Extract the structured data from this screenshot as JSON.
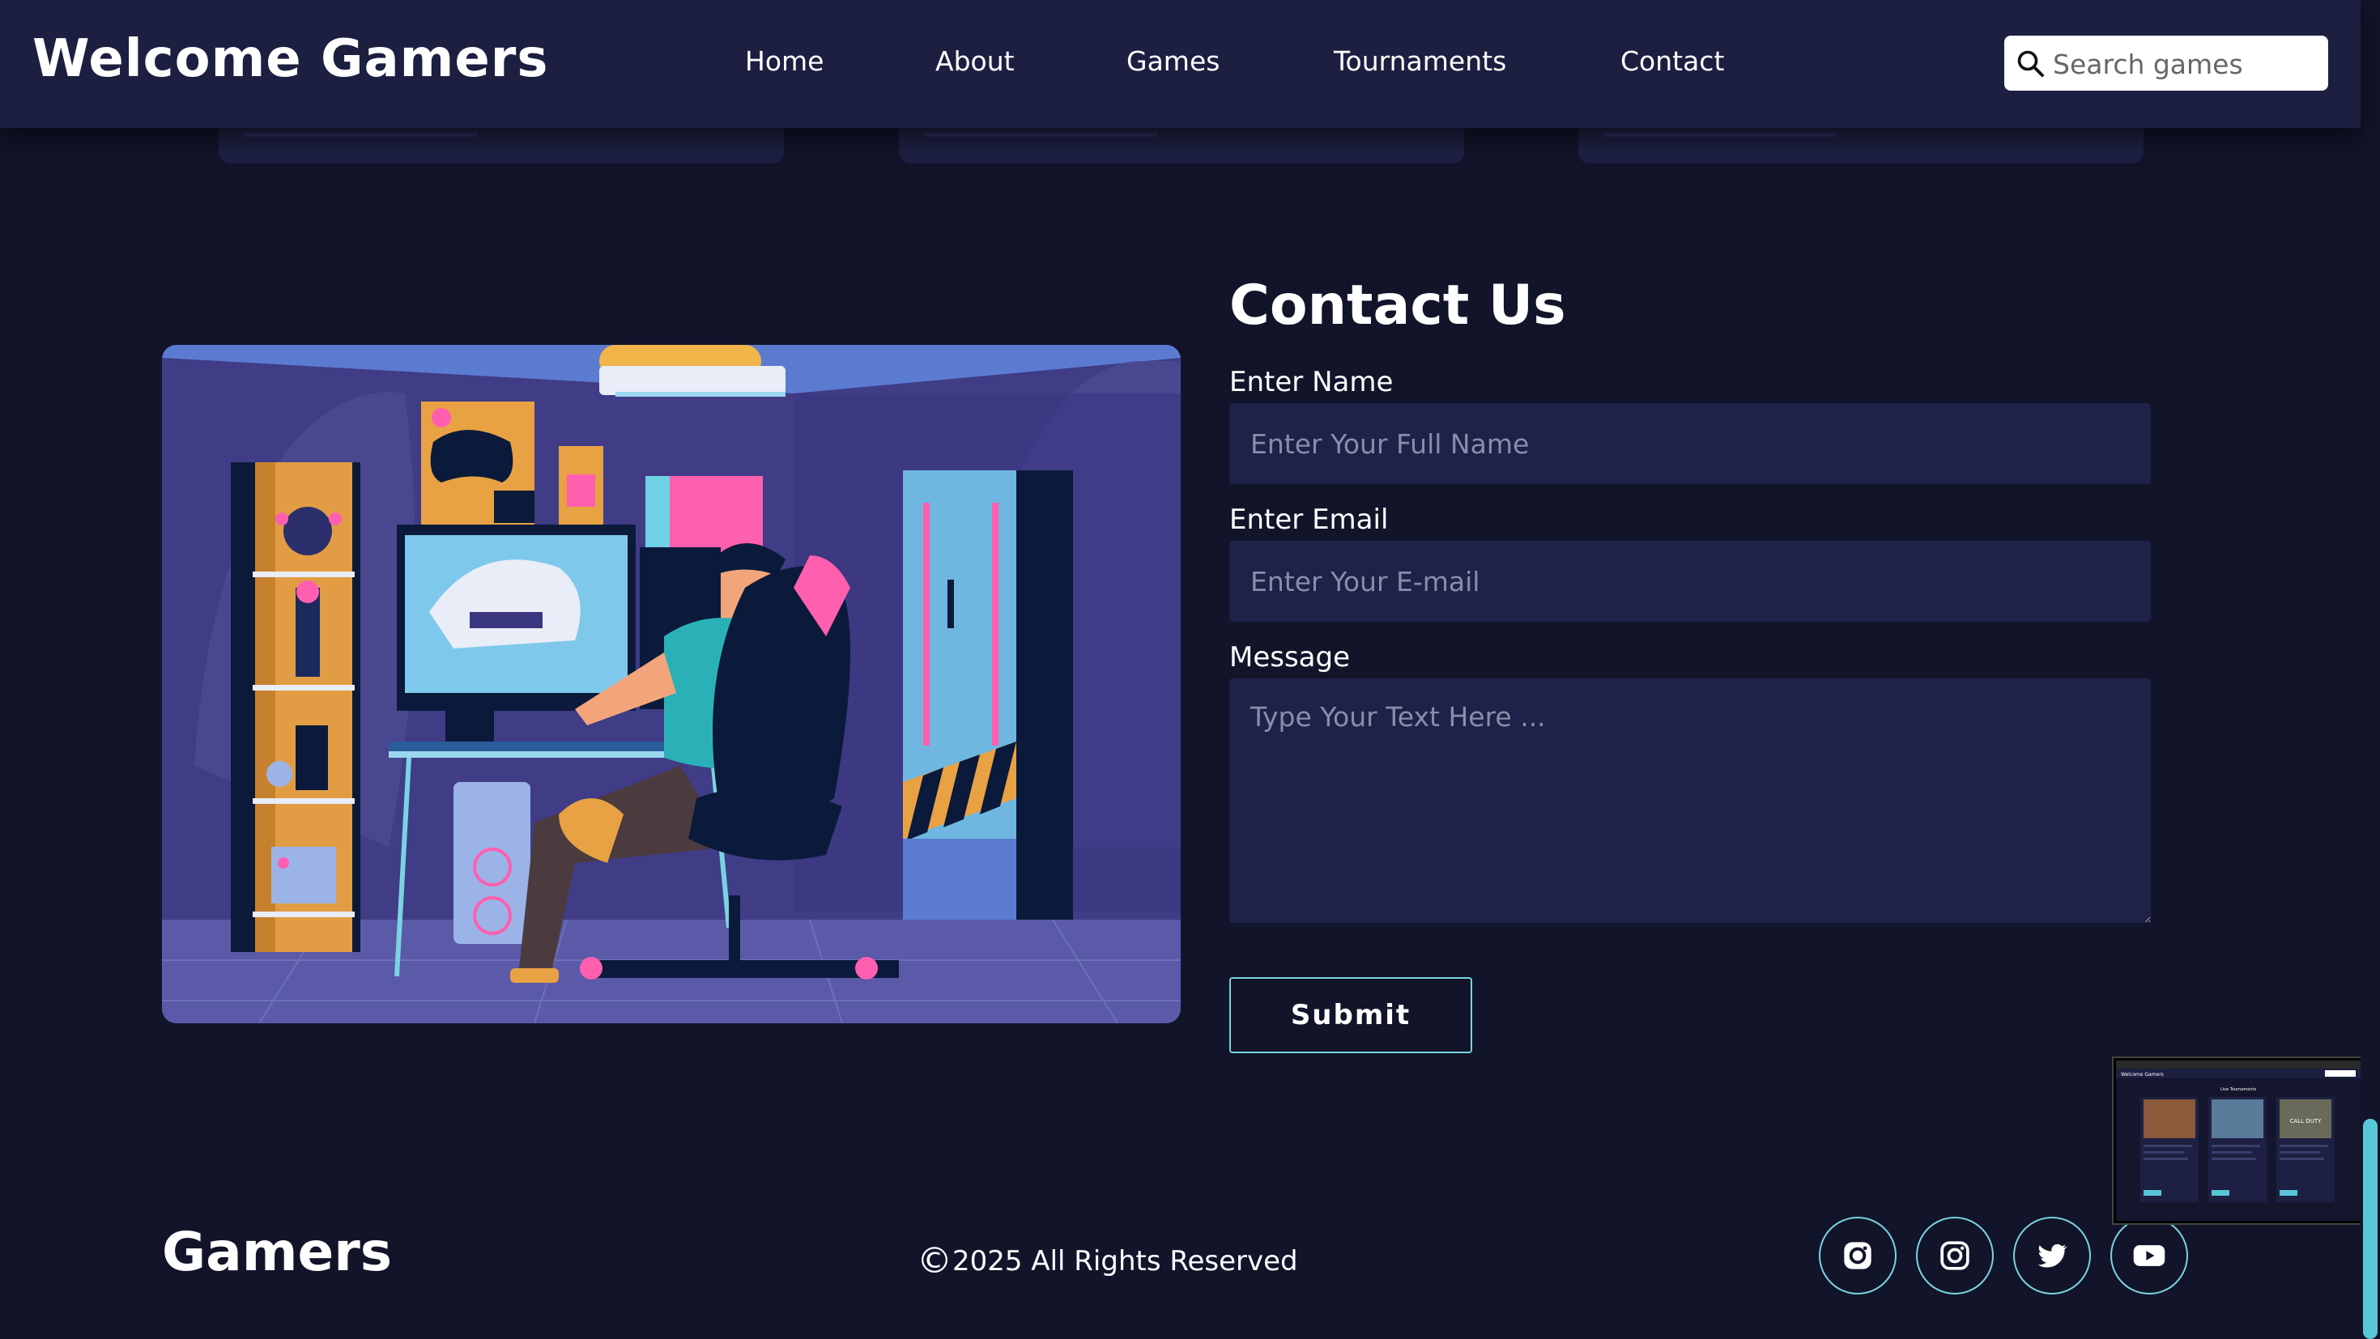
{
  "header": {
    "brand": "Welcome Gamers",
    "nav": [
      "Home",
      "About",
      "Games",
      "Tournaments",
      "Contact"
    ],
    "search_placeholder": "Search games"
  },
  "contact": {
    "title": "Contact Us",
    "name_label": "Enter Name",
    "name_placeholder": "Enter Your Full Name",
    "email_label": "Enter Email",
    "email_placeholder": "Enter Your E-mail",
    "message_label": "Message",
    "message_placeholder": "Type Your Text Here ...",
    "submit_label": "Submit"
  },
  "footer": {
    "brand": "Gamers",
    "copyright_symbol": "©",
    "copyright": "2025 All Rights Reserved",
    "social_icons": [
      "instagram-icon",
      "instagram-icon",
      "twitter-icon",
      "youtube-icon"
    ]
  },
  "thumbnail": {
    "brand": "Welcome Gamers",
    "heading": "Live Tournaments",
    "card_label": "CALL DUTY"
  },
  "colors": {
    "background": "#12142a",
    "header": "#1c1f40",
    "input": "#1e2148",
    "accent": "#7ad3e0",
    "scrollbar": "#58c7d8"
  }
}
